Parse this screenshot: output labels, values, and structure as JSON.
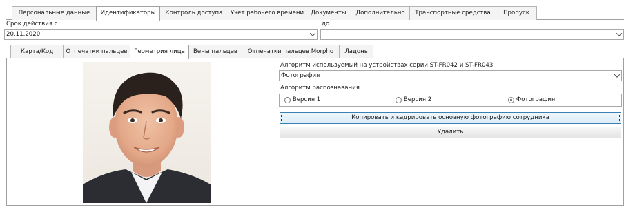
{
  "top_tabs": [
    {
      "label": "Персональные данные",
      "active": false
    },
    {
      "label": "Идентификаторы",
      "active": true
    },
    {
      "label": "Контроль доступа",
      "active": false
    },
    {
      "label": "Учет рабочего времени",
      "active": false
    },
    {
      "label": "Документы",
      "active": false
    },
    {
      "label": "Дополнительно",
      "active": false
    },
    {
      "label": "Транспортные средства",
      "active": false
    },
    {
      "label": "Пропуск",
      "active": false
    }
  ],
  "validity": {
    "from_label": "Срок действия с",
    "from_value": "20.11.2020",
    "to_label": "до",
    "to_value": ""
  },
  "sub_tabs": [
    {
      "label": "Карта/Код",
      "active": false
    },
    {
      "label": "Отпечатки пальцев",
      "active": false
    },
    {
      "label": "Геометрия лица",
      "active": true
    },
    {
      "label": "Вены пальцев",
      "active": false
    },
    {
      "label": "Отпечатки пальцев Morpho",
      "active": false
    },
    {
      "label": "Ладонь",
      "active": false
    }
  ],
  "face": {
    "algorithm_label": "Алгоритм используемый на устройствах серии ST-FR042 и ST-FR043",
    "algorithm_value": "Фотография",
    "recognition_label": "Алгоритм распознавания",
    "radios": [
      {
        "label": "Версия 1",
        "checked": false
      },
      {
        "label": "Версия 2",
        "checked": false
      },
      {
        "label": "Фотография",
        "checked": true
      }
    ],
    "copy_button": "Копировать и кадрировать основную фотографию сотрудника",
    "delete_button": "Удалить"
  }
}
